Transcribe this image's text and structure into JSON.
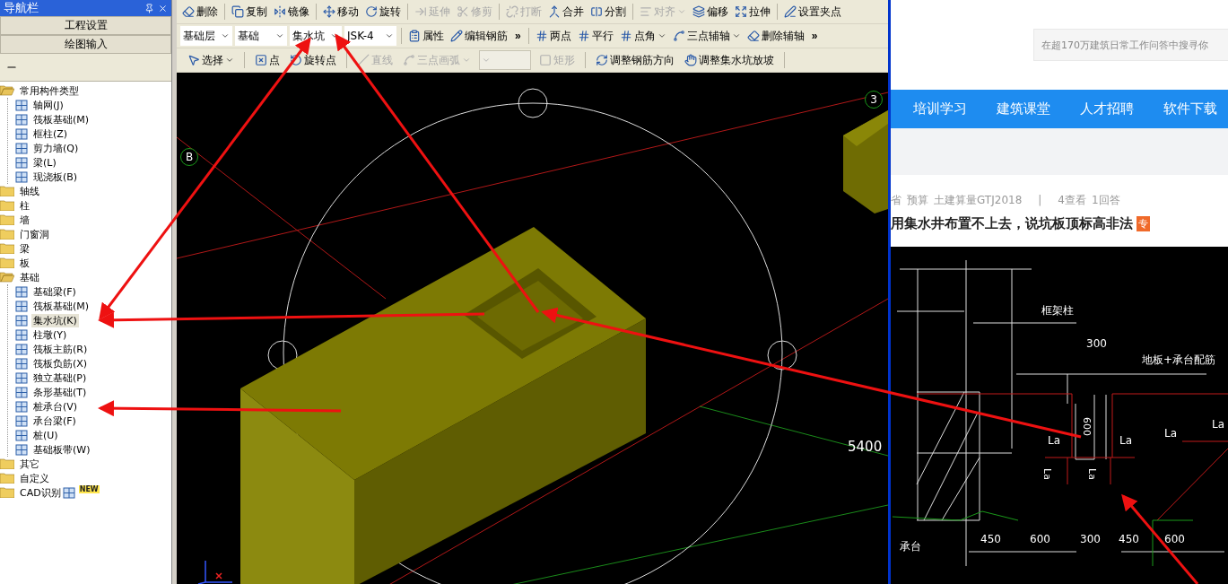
{
  "nav_panel": {
    "title": "导航栏",
    "buttons": [
      "工程设置",
      "绘图输入"
    ],
    "tree": [
      {
        "kind": "folder",
        "label": "常用构件类型",
        "expanded": true,
        "children": [
          {
            "kind": "item",
            "label": "轴网(J)",
            "selected": false
          },
          {
            "kind": "item",
            "label": "筏板基础(M)",
            "selected": false
          },
          {
            "kind": "item",
            "label": "框柱(Z)",
            "selected": false
          },
          {
            "kind": "item",
            "label": "剪力墙(Q)",
            "selected": false
          },
          {
            "kind": "item",
            "label": "梁(L)",
            "selected": false
          },
          {
            "kind": "item",
            "label": "现浇板(B)",
            "selected": false
          }
        ]
      },
      {
        "kind": "folder",
        "label": "轴线",
        "expanded": false
      },
      {
        "kind": "folder",
        "label": "柱",
        "expanded": false
      },
      {
        "kind": "folder",
        "label": "墙",
        "expanded": false
      },
      {
        "kind": "folder",
        "label": "门窗洞",
        "expanded": false
      },
      {
        "kind": "folder",
        "label": "梁",
        "expanded": false
      },
      {
        "kind": "folder",
        "label": "板",
        "expanded": false
      },
      {
        "kind": "folder",
        "label": "基础",
        "expanded": true,
        "children": [
          {
            "kind": "item",
            "label": "基础梁(F)",
            "selected": false
          },
          {
            "kind": "item",
            "label": "筏板基础(M)",
            "selected": false
          },
          {
            "kind": "item",
            "label": "集水坑(K)",
            "selected": true
          },
          {
            "kind": "item",
            "label": "柱墩(Y)",
            "selected": false
          },
          {
            "kind": "item",
            "label": "筏板主筋(R)",
            "selected": false
          },
          {
            "kind": "item",
            "label": "筏板负筋(X)",
            "selected": false
          },
          {
            "kind": "item",
            "label": "独立基础(P)",
            "selected": false
          },
          {
            "kind": "item",
            "label": "条形基础(T)",
            "selected": false
          },
          {
            "kind": "item",
            "label": "桩承台(V)",
            "selected": false
          },
          {
            "kind": "item",
            "label": "承台梁(F)",
            "selected": false
          },
          {
            "kind": "item",
            "label": "桩(U)",
            "selected": false
          },
          {
            "kind": "item",
            "label": "基础板带(W)",
            "selected": false
          }
        ]
      },
      {
        "kind": "folder",
        "label": "其它",
        "expanded": false
      },
      {
        "kind": "folder",
        "label": "自定义",
        "expanded": false
      },
      {
        "kind": "folder",
        "label": "CAD识别",
        "expanded": false,
        "badge": "NEW"
      }
    ]
  },
  "toolbars": [
    [
      {
        "kind": "button",
        "label": "删除",
        "disabled": false
      },
      {
        "kind": "separator"
      },
      {
        "kind": "button",
        "label": "复制",
        "disabled": false
      },
      {
        "kind": "button",
        "label": "镜像",
        "disabled": false
      },
      {
        "kind": "separator"
      },
      {
        "kind": "button",
        "label": "移动",
        "disabled": false
      },
      {
        "kind": "button",
        "label": "旋转",
        "disabled": false
      },
      {
        "kind": "separator"
      },
      {
        "kind": "button",
        "label": "延伸",
        "disabled": true
      },
      {
        "kind": "button",
        "label": "修剪",
        "disabled": true
      },
      {
        "kind": "separator"
      },
      {
        "kind": "button",
        "label": "打断",
        "disabled": true
      },
      {
        "kind": "button",
        "label": "合并",
        "disabled": false
      },
      {
        "kind": "button",
        "label": "分割",
        "disabled": false
      },
      {
        "kind": "separator"
      },
      {
        "kind": "dropdown",
        "label": "对齐",
        "disabled": true
      },
      {
        "kind": "button",
        "label": "偏移",
        "disabled": false
      },
      {
        "kind": "button",
        "label": "拉伸",
        "disabled": false
      },
      {
        "kind": "separator"
      },
      {
        "kind": "button",
        "label": "设置夹点",
        "disabled": false
      }
    ],
    [
      {
        "kind": "combo",
        "value": "基础层",
        "disabled": false
      },
      {
        "kind": "combo",
        "value": "基础",
        "disabled": false
      },
      {
        "kind": "combo",
        "value": "集水坑",
        "disabled": false
      },
      {
        "kind": "combo",
        "value": "JSK-4",
        "disabled": false
      },
      {
        "kind": "separator"
      },
      {
        "kind": "button",
        "label": "属性",
        "disabled": false
      },
      {
        "kind": "button",
        "label": "编辑钢筋",
        "disabled": false
      },
      {
        "kind": "more",
        "label": "»"
      },
      {
        "kind": "separator"
      },
      {
        "kind": "button",
        "label": "两点",
        "disabled": false
      },
      {
        "kind": "button",
        "label": "平行",
        "disabled": false
      },
      {
        "kind": "dropdown",
        "label": "点角",
        "disabled": false
      },
      {
        "kind": "dropdown",
        "label": "三点辅轴",
        "disabled": false
      },
      {
        "kind": "button",
        "label": "删除辅轴",
        "disabled": false
      },
      {
        "kind": "more",
        "label": "»"
      }
    ],
    [
      {
        "kind": "dropdown",
        "label": "选择",
        "disabled": false
      },
      {
        "kind": "separator"
      },
      {
        "kind": "button",
        "label": "点",
        "disabled": false
      },
      {
        "kind": "button",
        "label": "旋转点",
        "disabled": false
      },
      {
        "kind": "separator"
      },
      {
        "kind": "button",
        "label": "直线",
        "disabled": true
      },
      {
        "kind": "dropdown",
        "label": "三点画弧",
        "disabled": true
      },
      {
        "kind": "combo",
        "disabled": true
      },
      {
        "kind": "button",
        "label": "矩形",
        "disabled": true
      },
      {
        "kind": "separator"
      },
      {
        "kind": "button",
        "label": "调整钢筋方向",
        "disabled": false
      },
      {
        "kind": "button",
        "label": "调整集水坑放坡",
        "disabled": false
      },
      {
        "kind": "separator"
      }
    ]
  ],
  "viewport": {
    "axis_labels": [
      "B",
      "3"
    ],
    "dimension": "5400"
  },
  "web_page": {
    "search": {
      "placeholder": "在超170万建筑日常工作问答中搜寻你"
    },
    "nav_links": [
      "培训学习",
      "建筑课堂",
      "人才招聘",
      "软件下载"
    ],
    "question_meta": [
      "省",
      "预算",
      "土建算量GTJ2018",
      "|",
      "4查看",
      "1回答"
    ],
    "question_title": "用集水井布置不上去，说坑板顶标高非法",
    "title_badge": "专",
    "cad_labels": [
      "框架柱",
      "300",
      "地板+承台配筋",
      "La",
      "La",
      "La",
      "La",
      "承台"
    ],
    "cad_rotated_labels": [
      "600",
      "La",
      "La"
    ],
    "cad_dimensions": [
      "450",
      "600",
      "300",
      "450",
      "600"
    ]
  }
}
